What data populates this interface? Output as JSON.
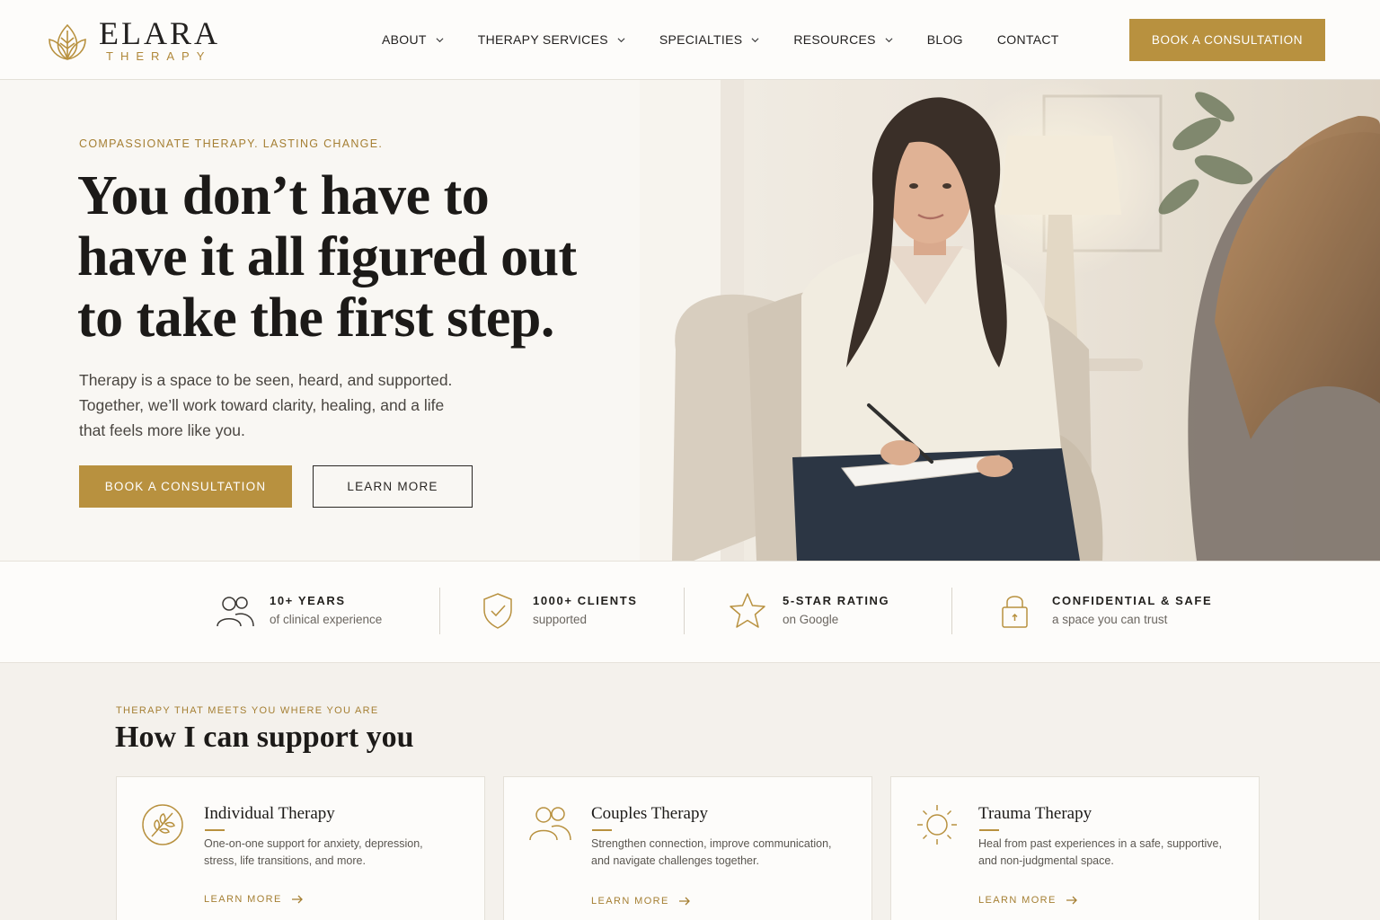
{
  "brand": {
    "name": "ELARA",
    "tagline": "THERAPY",
    "accent": "#b8913f",
    "icon": "lotus-leaf-icon"
  },
  "nav": {
    "items": [
      {
        "label": "ABOUT",
        "dropdown": true
      },
      {
        "label": "THERAPY SERVICES",
        "dropdown": true
      },
      {
        "label": "SPECIALTIES",
        "dropdown": true
      },
      {
        "label": "RESOURCES",
        "dropdown": true
      },
      {
        "label": "BLOG",
        "dropdown": false
      },
      {
        "label": "CONTACT",
        "dropdown": false
      }
    ],
    "cta": "BOOK A CONSULTATION"
  },
  "hero": {
    "eyebrow": "COMPASSIONATE THERAPY. LASTING CHANGE.",
    "title": "You don’t have to have it all figured out to take the first step.",
    "body": "Therapy is a space to be seen, heard, and supported. Together, we’ll work toward clarity, healing, and a life that feels more like you.",
    "primary_button": "BOOK A CONSULTATION",
    "secondary_button": "LEARN MORE"
  },
  "stats": [
    {
      "icon": "people-icon",
      "title": "10+ YEARS",
      "subtitle": "of clinical experience"
    },
    {
      "icon": "shield-check-icon",
      "title": "1000+ CLIENTS",
      "subtitle": "supported"
    },
    {
      "icon": "star-icon",
      "title": "5-STAR RATING",
      "subtitle": "on Google"
    },
    {
      "icon": "lock-icon",
      "title": "CONFIDENTIAL & SAFE",
      "subtitle": "a space you can trust"
    }
  ],
  "services": {
    "eyebrow": "THERAPY THAT MEETS YOU WHERE YOU ARE",
    "title": "How I can support you",
    "cards": [
      {
        "icon": "leaf-icon",
        "title": "Individual Therapy",
        "description": "One-on-one support for anxiety, depression, stress, life transitions, and more.",
        "link": "LEARN MORE"
      },
      {
        "icon": "couple-icon",
        "title": "Couples Therapy",
        "description": "Strengthen connection, improve communication, and navigate challenges together.",
        "link": "LEARN MORE"
      },
      {
        "icon": "sun-icon",
        "title": "Trauma Therapy",
        "description": "Heal from past experiences in a safe, supportive, and non-judgmental space.",
        "link": "LEARN MORE"
      }
    ]
  }
}
